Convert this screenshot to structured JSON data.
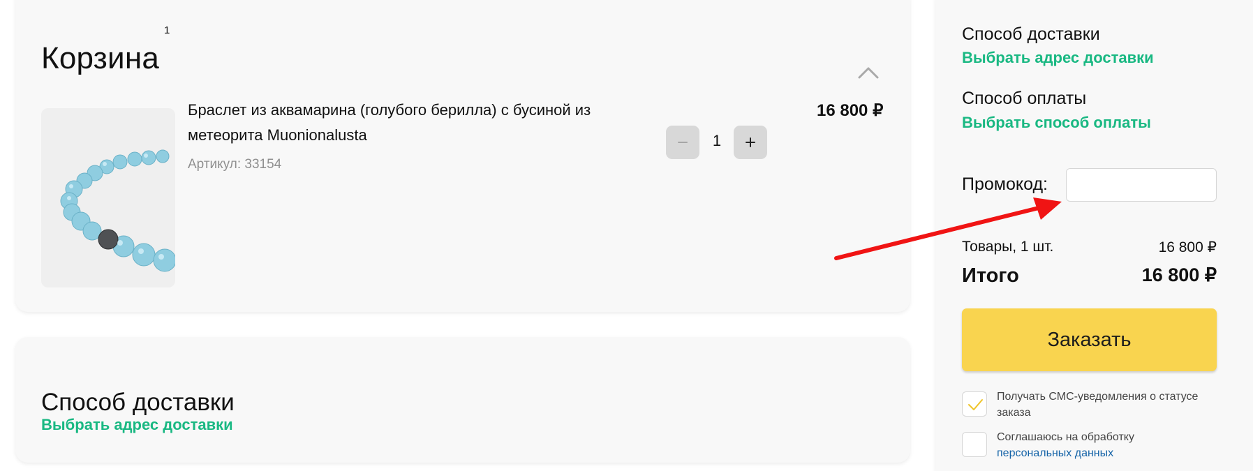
{
  "cart": {
    "title": "Корзина",
    "count": "1",
    "product": {
      "name": "Браслет из аквамарина (голубого берилла) с бусиной из метеорита Muonionalusta",
      "sku": "Артикул: 33154",
      "quantity": "1",
      "price": "16 800 ₽",
      "image_semantic": "aquamarine-bracelet-image"
    },
    "icons": {
      "collapse": "chevron-up-icon",
      "decrease": "minus-icon",
      "increase": "plus-icon"
    }
  },
  "delivery_section": {
    "title": "Способ доставки",
    "link": "Выбрать адрес доставки"
  },
  "sidebar": {
    "shipping": {
      "title": "Способ доставки",
      "link": "Выбрать адрес доставки"
    },
    "payment": {
      "title": "Способ оплаты",
      "link": "Выбрать способ оплаты"
    },
    "promo": {
      "label": "Промокод:",
      "value": ""
    },
    "summary": {
      "goods_label": "Товары, 1 шт.",
      "goods_value": "16 800 ₽",
      "total_label": "Итого",
      "total_value": "16 800 ₽"
    },
    "order_button": "Заказать",
    "checkboxes": {
      "sms": {
        "label": "Получать СМС-уведомления о статусе заказа",
        "checked": true
      },
      "privacy": {
        "label_prefix": "Соглашаюсь на обработку",
        "link": "персональных данных",
        "checked": false
      }
    }
  },
  "colors": {
    "accent_green": "#19b882",
    "button_yellow": "#f9d44f",
    "arrow_red": "#f01414",
    "link_blue": "#1664a8"
  },
  "annotation": {
    "icon": "red-arrow-icon"
  }
}
